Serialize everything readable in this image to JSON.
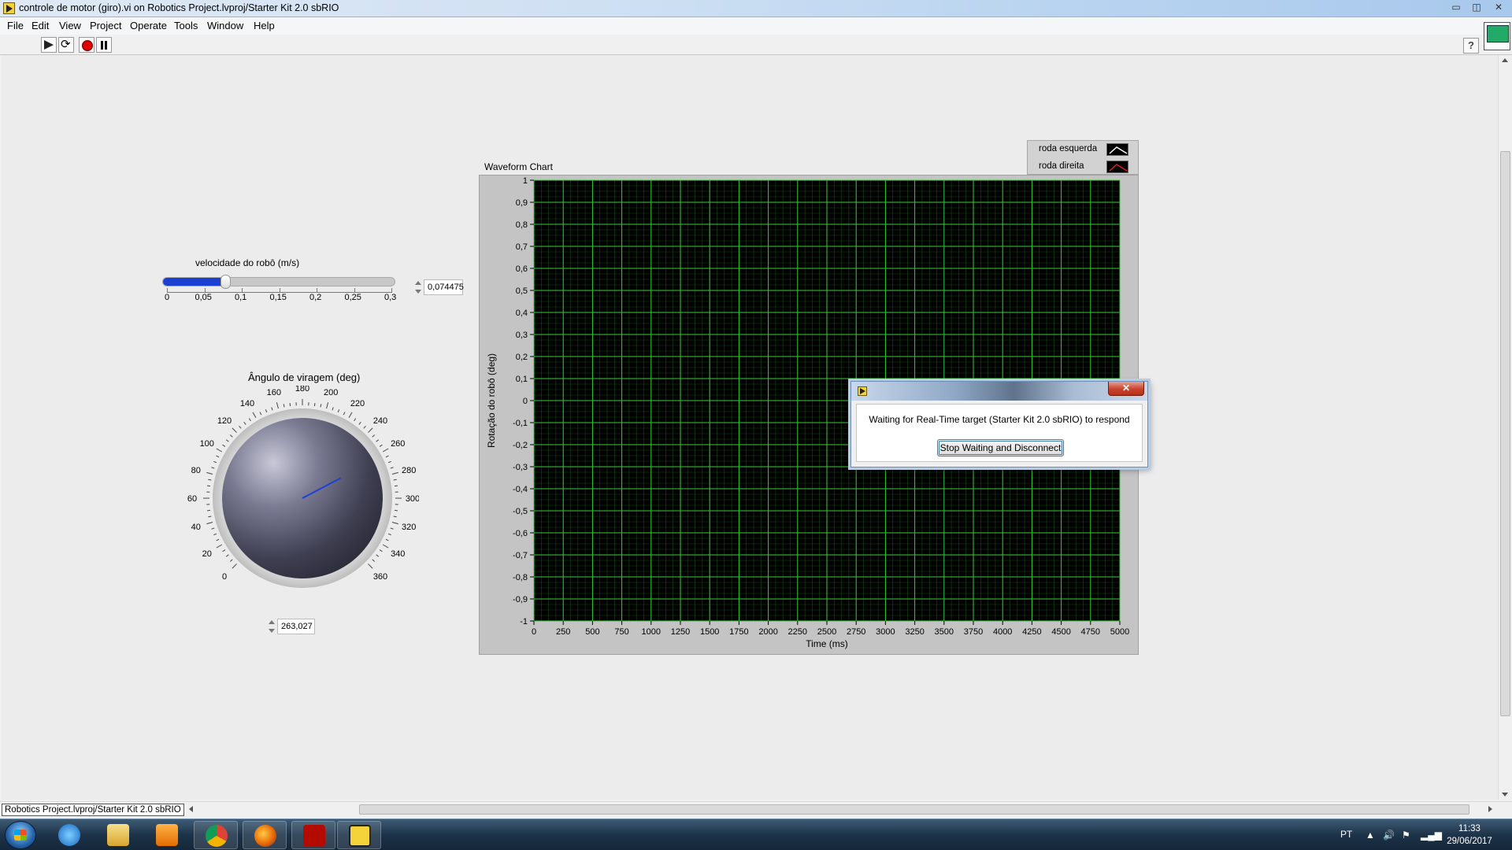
{
  "window": {
    "title": "controle de motor (giro).vi on Robotics Project.lvproj/Starter Kit 2.0 sbRIO",
    "controls": {
      "minimize": "▭",
      "maximize": "◫",
      "close": "✕"
    }
  },
  "menu": [
    "File",
    "Edit",
    "View",
    "Project",
    "Operate",
    "Tools",
    "Window",
    "Help"
  ],
  "toolbar": {
    "run": "run-arrow-icon",
    "run_continuously": "run-continuously-icon",
    "abort": "abort-stop-icon",
    "pause": "pause-icon",
    "help": "?"
  },
  "slider": {
    "label": "velocidade do robô (m/s)",
    "value": 0.074475,
    "value_text": "0,074475",
    "min": 0,
    "max": 0.3,
    "ticks": [
      "0",
      "0,05",
      "0,1",
      "0,15",
      "0,2",
      "0,25",
      "0,3"
    ],
    "fill_color": "#1a3fd1"
  },
  "knob": {
    "label": "Ângulo de viragem (deg)",
    "value": 263.027,
    "value_text": "263,027",
    "min": 0,
    "max": 360,
    "ticks": [
      "0",
      "20",
      "40",
      "60",
      "80",
      "100",
      "120",
      "140",
      "160",
      "180",
      "200",
      "220",
      "240",
      "260",
      "280",
      "300",
      "320",
      "340",
      "360"
    ],
    "needle_color": "#1f3fd6"
  },
  "chart_data": {
    "type": "line",
    "title": "Waveform Chart",
    "xlabel": "Time (ms)",
    "ylabel": "Rotação do robô  (deg)",
    "xlim": [
      0,
      5000
    ],
    "ylim": [
      -1,
      1
    ],
    "x_ticks": [
      "0",
      "250",
      "500",
      "750",
      "1000",
      "1250",
      "1500",
      "1750",
      "2000",
      "2250",
      "2500",
      "2750",
      "3000",
      "3250",
      "3500",
      "3750",
      "4000",
      "4250",
      "4500",
      "4750",
      "5000"
    ],
    "y_ticks": [
      "1",
      "0,9",
      "0,8",
      "0,7",
      "0,6",
      "0,5",
      "0,4",
      "0,3",
      "0,2",
      "0,1",
      "0",
      "-0,1",
      "-0,2",
      "-0,3",
      "-0,4",
      "-0,5",
      "-0,6",
      "-0,7",
      "-0,8",
      "-0,9",
      "-1"
    ],
    "grid": true,
    "plot_background": "#000000",
    "grid_color": "#33cc33",
    "series": [
      {
        "name": "roda esquerda",
        "color": "#ffffff",
        "values": []
      },
      {
        "name": "roda direita",
        "color": "#e02020",
        "values": []
      }
    ],
    "legend": "top-right"
  },
  "dialog": {
    "message": "Waiting for Real-Time target (Starter Kit 2.0 sbRIO) to respond",
    "button": "Stop Waiting and Disconnect",
    "close": "✕"
  },
  "status": {
    "path": "Robotics Project.lvproj/Starter Kit 2.0 sbRIO"
  },
  "taskbar": {
    "apps": [
      "windows-start-icon",
      "internet-explorer-icon",
      "file-explorer-icon",
      "media-player-icon",
      "chrome-icon",
      "firefox-icon",
      "acrobat-icon",
      "labview-icon"
    ],
    "tray": {
      "language": "PT",
      "time": "11:33",
      "date": "29/06/2017"
    }
  }
}
